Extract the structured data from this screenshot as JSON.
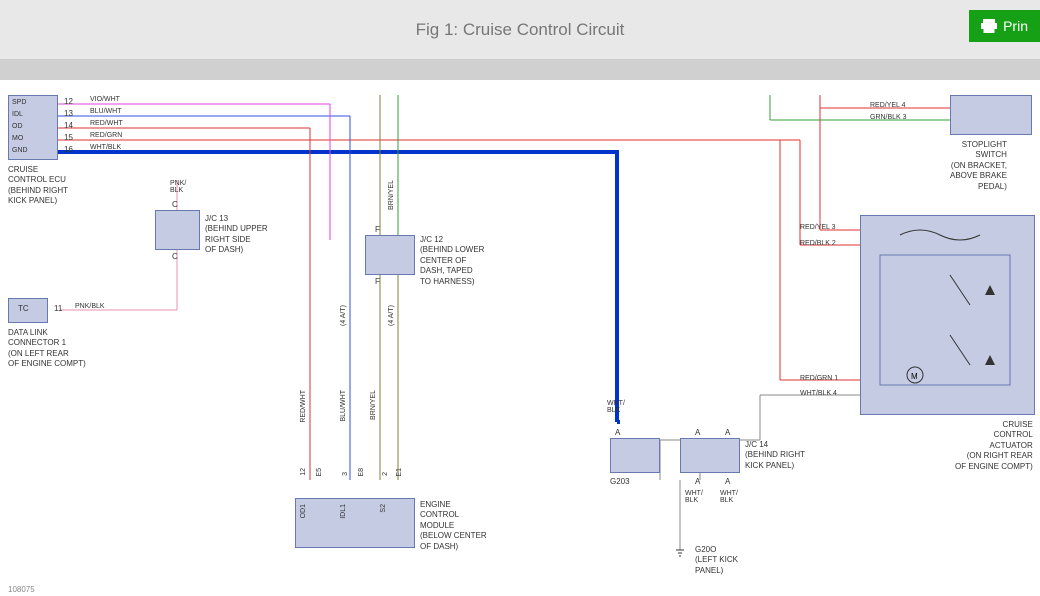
{
  "header": {
    "title": "Fig 1: Cruise Control Circuit",
    "print": "Prin"
  },
  "ecu": {
    "pins": [
      "SPD",
      "IDL",
      "OD",
      "MO",
      "GND"
    ],
    "nums": [
      "12",
      "13",
      "14",
      "15",
      "16"
    ],
    "colors": [
      "VIO/WHT",
      "BLU/WHT",
      "RED/WHT",
      "RED/GRN",
      "WHT/BLK"
    ],
    "desc": "CRUISE\nCONTROL ECU\n(BEHIND RIGHT\nKICK PANEL)"
  },
  "jc13": {
    "top": "PNK/\nBLK",
    "c1": "C",
    "c2": "C",
    "desc": "J/C 13\n(BEHIND UPPER\nRIGHT SIDE\nOF DASH)"
  },
  "jc12": {
    "f1": "F",
    "f2": "F",
    "desc": "J/C 12\n(BEHIND LOWER\nCENTER OF\nDASH, TAPED\nTO HARNESS)"
  },
  "dlc": {
    "pin": "TC",
    "num": "11",
    "color": "PNK/BLK",
    "desc": "DATA LINK\nCONNECTOR 1\n(ON LEFT REAR\nOF ENGINE COMPT)"
  },
  "ecm": {
    "pins": [
      "OD1",
      "IDL1",
      "S2"
    ],
    "nums": [
      "12",
      "E5",
      "3",
      "E8",
      "2",
      "E1"
    ],
    "desc": "ENGINE\nCONTROL\nMODULE\n(BELOW CENTER\nOF DASH)"
  },
  "vert": {
    "redwht": "RED/WHT",
    "bluwht": "BLU/WHT",
    "brnyel": "BRN/YEL",
    "brnyel2": "BRN/YEL",
    "at1": "(4 A/T)",
    "at2": "(4 A/T)"
  },
  "g203": {
    "a": "A",
    "wht": "WHT/\nBLK",
    "name": "G203"
  },
  "jc14": {
    "a": "A",
    "wht": "WHT/\nBLK",
    "desc": "J/C 14\n(BEHIND RIGHT\nKICK PANEL)"
  },
  "g200": {
    "name": "G20O\n(LEFT KICK\nPANEL)"
  },
  "stoplight": {
    "wires": [
      "RED/YEL 4",
      "GRN/BLK 3"
    ],
    "desc": "STOPLIGHT\nSWITCH\n(ON BRACKET,\nABOVE BRAKE\nPEDAL)"
  },
  "actuator": {
    "wires": [
      "RED/YEL 3",
      "RED/BLK 2",
      "RED/GRN 1",
      "WHT/BLK 4"
    ],
    "m": "M",
    "desc": "CRUISE\nCONTROL\nACTUATOR\n(ON RIGHT REAR\nOF ENGINE COMPT)"
  },
  "img_id": "108075"
}
